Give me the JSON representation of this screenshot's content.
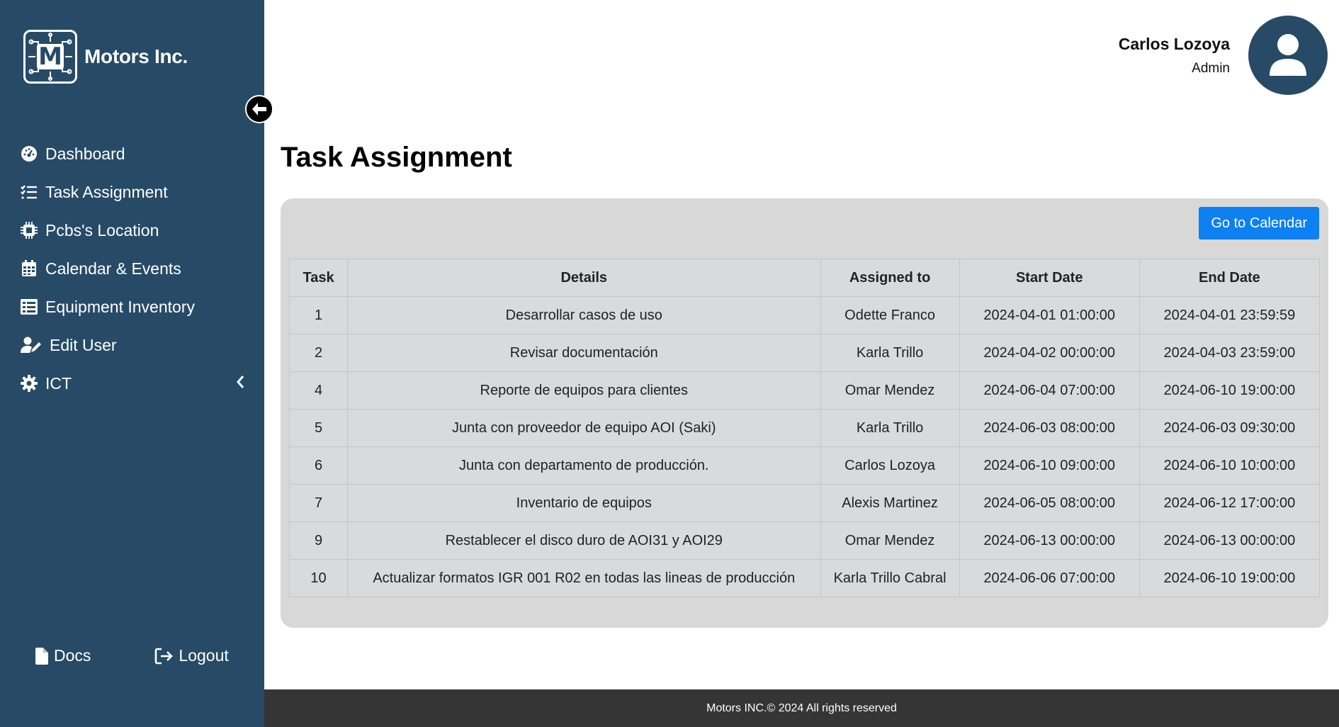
{
  "brand": {
    "name": "Motors Inc.",
    "logo_letter": "M"
  },
  "sidebar": {
    "items": [
      {
        "label": "Dashboard",
        "icon": "gauge-icon"
      },
      {
        "label": "Task Assignment",
        "icon": "list-check-icon"
      },
      {
        "label": "Pcbs's Location",
        "icon": "microchip-icon"
      },
      {
        "label": "Calendar & Events",
        "icon": "calendar-icon"
      },
      {
        "label": "Equipment Inventory",
        "icon": "table-list-icon"
      },
      {
        "label": "Edit User",
        "icon": "user-pen-icon"
      },
      {
        "label": "ICT",
        "icon": "gear-icon",
        "expandable": true
      }
    ],
    "bottom": {
      "docs": "Docs",
      "logout": "Logout"
    }
  },
  "user": {
    "name": "Carlos Lozoya",
    "role": "Admin"
  },
  "page": {
    "title": "Task Assignment",
    "calendar_button": "Go to Calendar"
  },
  "table": {
    "headers": [
      "Task",
      "Details",
      "Assigned to",
      "Start Date",
      "End Date"
    ],
    "rows": [
      [
        "1",
        "Desarrollar casos de uso",
        "Odette Franco",
        "2024-04-01 01:00:00",
        "2024-04-01 23:59:59"
      ],
      [
        "2",
        "Revisar documentación",
        "Karla Trillo",
        "2024-04-02 00:00:00",
        "2024-04-03 23:59:00"
      ],
      [
        "4",
        "Reporte de equipos para clientes",
        "Omar Mendez",
        "2024-06-04 07:00:00",
        "2024-06-10 19:00:00"
      ],
      [
        "5",
        "Junta con proveedor de equipo AOI (Saki)",
        "Karla Trillo",
        "2024-06-03 08:00:00",
        "2024-06-03 09:30:00"
      ],
      [
        "6",
        "Junta con departamento de producción.",
        "Carlos Lozoya",
        "2024-06-10 09:00:00",
        "2024-06-10 10:00:00"
      ],
      [
        "7",
        "Inventario de equipos",
        "Alexis Martinez",
        "2024-06-05 08:00:00",
        "2024-06-12 17:00:00"
      ],
      [
        "9",
        "Restablecer el disco duro de AOI31 y AOI29",
        "Omar Mendez",
        "2024-06-13 00:00:00",
        "2024-06-13 00:00:00"
      ],
      [
        "10",
        "Actualizar formatos IGR 001 R02 en todas las lineas de producción",
        "Karla Trillo Cabral",
        "2024-06-06 07:00:00",
        "2024-06-10 19:00:00"
      ]
    ]
  },
  "footer": {
    "text": "Motors INC.© 2024 All rights reserved"
  },
  "colors": {
    "sidebar_bg": "#274b66",
    "accent": "#0d80f2",
    "footer_bg": "#353535",
    "panel_bg": "#d8d8d8"
  }
}
